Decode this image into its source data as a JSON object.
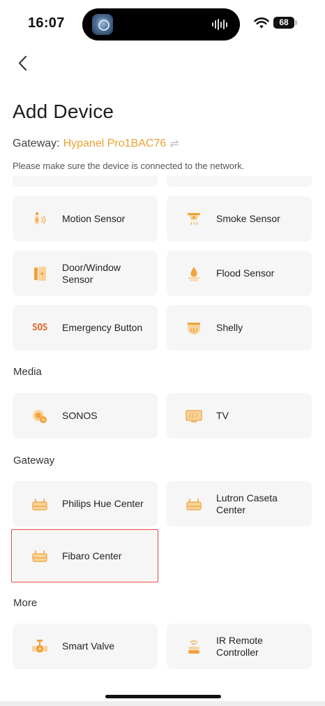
{
  "status_bar": {
    "time": "16:07",
    "battery": "68"
  },
  "header": {
    "title": "Add Device",
    "gateway_label": "Gateway:",
    "gateway_name": "Hypanel Pro1BAC76",
    "hint": "Please make sure the device is connected to the network."
  },
  "sensors": {
    "motion": "Motion Sensor",
    "smoke": "Smoke Sensor",
    "door_window": "Door/Window Sensor",
    "flood": "Flood Sensor",
    "emergency": "Emergency Button",
    "shelly": "Shelly"
  },
  "media": {
    "title": "Media",
    "sonos": "SONOS",
    "tv": "TV"
  },
  "gateway_section": {
    "title": "Gateway",
    "philips": "Philips Hue Center",
    "lutron": "Lutron Caseta Center",
    "fibaro": "Fibaro Center"
  },
  "more": {
    "title": "More",
    "valve": "Smart Valve",
    "ir": "IR Remote Controller"
  },
  "icons": {
    "sos_text": "SOS",
    "accent": "#f0a23b",
    "accent_light": "#f8d39a",
    "selection": "#e2463f"
  }
}
